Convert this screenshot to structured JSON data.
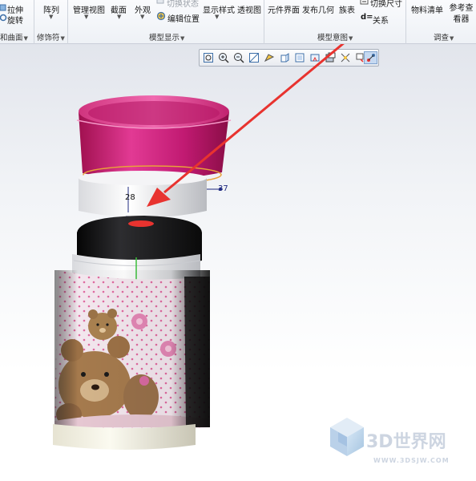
{
  "ribbon": {
    "shape_tools": {
      "extrude_label": "拉伸",
      "revolve_label": "旋转"
    },
    "pattern_label": "阵列",
    "view_manager_label": "管理视图",
    "section_label": "截面",
    "appearance_label": "外观",
    "switch_state_label": "切换状态",
    "edit_position_label": "编辑位置",
    "display_style_label": "显示样式",
    "perspective_label": "透视图",
    "component_interface_label": "元件界面",
    "publish_geometry_label": "发布几何",
    "family_table_label": "族表",
    "switch_dimensions_label": "切换尺寸",
    "relations_label": "关系",
    "relations_prefix": "d=",
    "bom_label": "物料清单",
    "reference_viewer_label": "参考查看器",
    "groups": {
      "surfaces": "和曲面",
      "modifiers": "修饰符",
      "model_display": "模型显示",
      "model_intent": "模型意图",
      "investigate": "调查"
    }
  },
  "viewport": {
    "dimensions": {
      "d1": "28",
      "d2": "37"
    }
  },
  "watermark": {
    "brand": "3D世界网",
    "url": "WWW.3DSJW.COM"
  },
  "colors": {
    "cap_pink": "#d6207f",
    "arrow_red": "#e8332f",
    "ribbon_bg": "#eef1f6",
    "accent_active": "#c6d9f1"
  }
}
